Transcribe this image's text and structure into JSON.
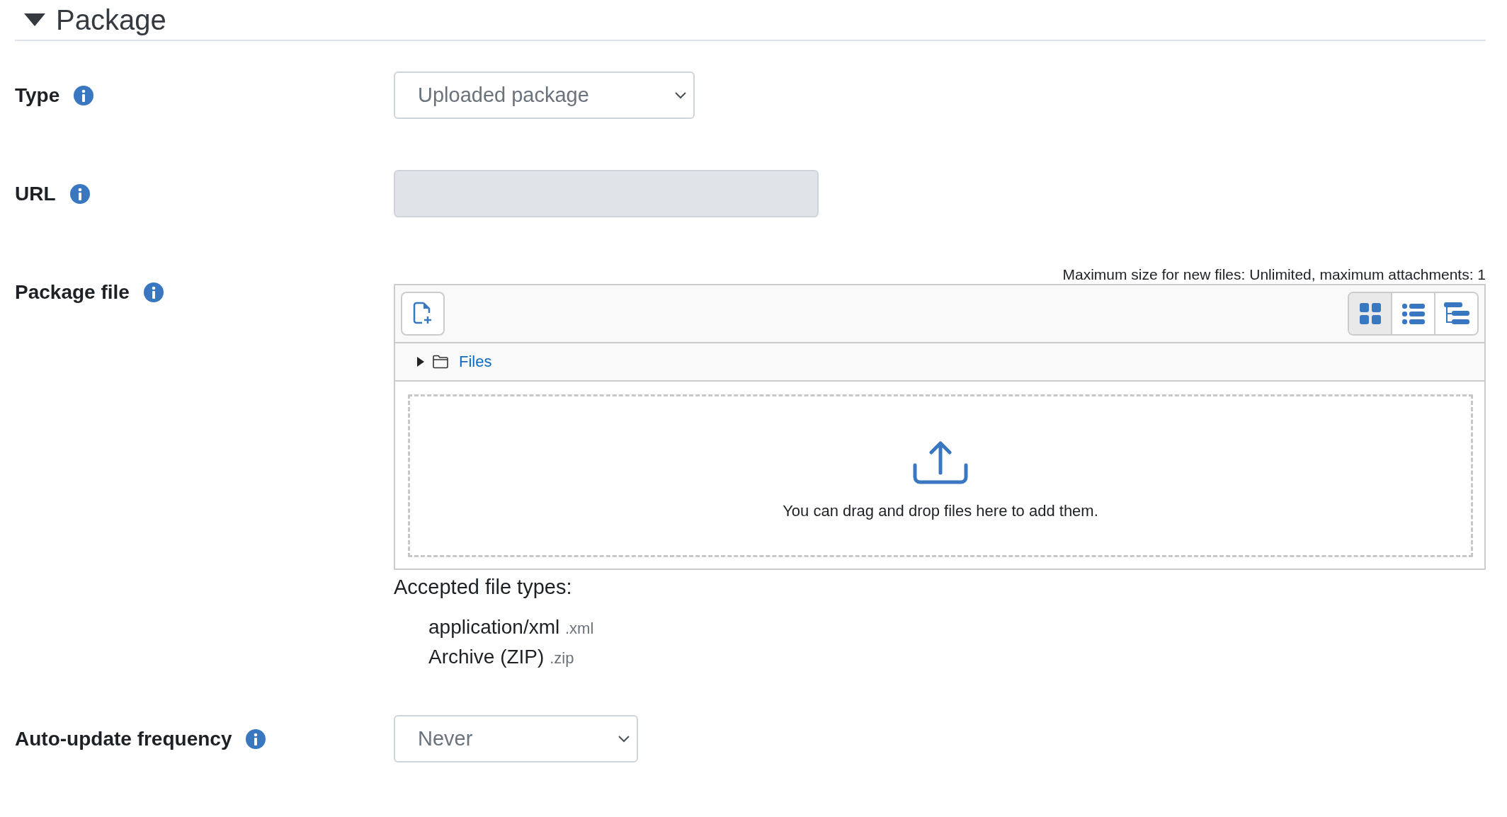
{
  "section": {
    "title": "Package",
    "expanded": true
  },
  "fields": [
    {
      "kind": "select",
      "label": "Type",
      "value": "Uploaded package"
    },
    {
      "kind": "text",
      "label": "URL",
      "disabled": true
    },
    {
      "kind": "filepicker",
      "label": "Package file",
      "limits": "Maximum size for new files: Unlimited, maximum attachments: 1",
      "views": [
        {
          "kind": "grid",
          "selected": true
        },
        {
          "kind": "list",
          "selected": false
        },
        {
          "kind": "tree",
          "selected": false
        }
      ],
      "folder": {
        "label": "Files",
        "expanded": false
      },
      "drop_hint": "You can drag and drop files here to add them.",
      "accepted_title": "Accepted file types:",
      "accepted": [
        {
          "name": "application/xml",
          "ext": ".xml"
        },
        {
          "name": "Archive (ZIP)",
          "ext": ".zip"
        }
      ]
    },
    {
      "kind": "select",
      "label": "Auto-update frequency",
      "value": "Never"
    }
  ]
}
